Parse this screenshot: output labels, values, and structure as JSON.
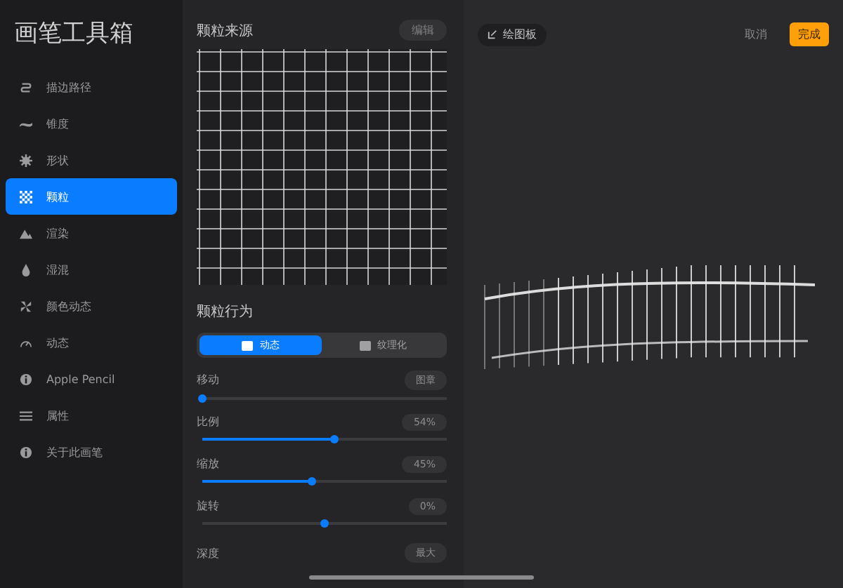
{
  "sidebar": {
    "title": "画笔工具箱",
    "items": [
      {
        "label": "描边路径",
        "selected": false
      },
      {
        "label": "锥度",
        "selected": false
      },
      {
        "label": "形状",
        "selected": false
      },
      {
        "label": "颗粒",
        "selected": true
      },
      {
        "label": "渲染",
        "selected": false
      },
      {
        "label": "湿混",
        "selected": false
      },
      {
        "label": "颜色动态",
        "selected": false
      },
      {
        "label": "动态",
        "selected": false
      },
      {
        "label": "Apple Pencil",
        "selected": false
      },
      {
        "label": "属性",
        "selected": false
      },
      {
        "label": "关于此画笔",
        "selected": false
      }
    ]
  },
  "grain_source": {
    "title": "颗粒来源",
    "edit_button": "编辑"
  },
  "grain_behavior": {
    "title": "颗粒行为",
    "tabs": [
      {
        "label": "动态",
        "selected": true
      },
      {
        "label": "纹理化",
        "selected": false
      }
    ],
    "settings": [
      {
        "label": "移动",
        "value": "图章",
        "kind": "fill",
        "level": 0
      },
      {
        "label": "比例",
        "value": "54%",
        "kind": "fill",
        "level": 0.54
      },
      {
        "label": "缩放",
        "value": "45%",
        "kind": "fill",
        "level": 0.45
      },
      {
        "label": "旋转",
        "value": "0%",
        "kind": "center",
        "level": 0.5
      },
      {
        "label": "深度",
        "value": "最大",
        "kind": "none"
      }
    ]
  },
  "canvas": {
    "drawing_pad_button": "绘图板",
    "cancel": "取消",
    "done": "完成"
  }
}
